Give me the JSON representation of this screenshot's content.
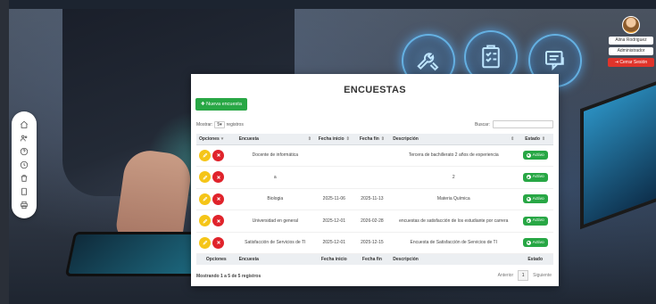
{
  "user": {
    "name": "Alina Rodriguez",
    "role": "Administrador",
    "logout_label": "Cerrar Sesión"
  },
  "side_nav": {
    "icons": [
      "home-icon",
      "users-icon",
      "help-icon",
      "clock-icon",
      "trash-icon",
      "tablet-icon",
      "print-icon"
    ]
  },
  "header_icons": [
    "tools-icon",
    "checklist-icon",
    "survey-chat-icon"
  ],
  "page": {
    "title": "ENCUESTAS",
    "new_button": "Nueva encuesta",
    "show_label": "Mostrar:",
    "show_value": "5",
    "records_label": "registros",
    "search_label": "Buscar:",
    "search_value": ""
  },
  "table": {
    "columns": [
      "Opciones",
      "Encuesta",
      "Fecha inicio",
      "Fecha fin",
      "Descripción",
      "Estado"
    ],
    "rows": [
      {
        "encuesta": "Docente de informática",
        "fecha_inicio": "",
        "fecha_fin": "",
        "descripcion": "Tercera de bachillerato 2 años de experiencia",
        "estado": "Activo"
      },
      {
        "encuesta": "a",
        "fecha_inicio": "",
        "fecha_fin": "",
        "descripcion": "2",
        "estado": "Activo"
      },
      {
        "encuesta": "Biologia",
        "fecha_inicio": "2025-11-06",
        "fecha_fin": "2025-11-13",
        "descripcion": "Materia Química",
        "estado": "Activo"
      },
      {
        "encuesta": "Universidad en general",
        "fecha_inicio": "2025-12-01",
        "fecha_fin": "2026-02-28",
        "descripcion": "encuestas de satisfacción de los estudiante por carrera",
        "estado": "Activo"
      },
      {
        "encuesta": "Satisfacción de Servicios de TI",
        "fecha_inicio": "2025-12-01",
        "fecha_fin": "2025-12-15",
        "descripcion": "Encuesta de Satisfacción de Servicios de TI",
        "estado": "Activo"
      }
    ]
  },
  "footer": {
    "info": "Mostrando 1 a 5 de 5 registros",
    "prev": "Anterior",
    "page": "1",
    "next": "Siguiente"
  },
  "colors": {
    "primary_green": "#28a745",
    "edit_yellow": "#f5c518",
    "delete_red": "#e0232b",
    "logout_red": "#e0342b"
  }
}
